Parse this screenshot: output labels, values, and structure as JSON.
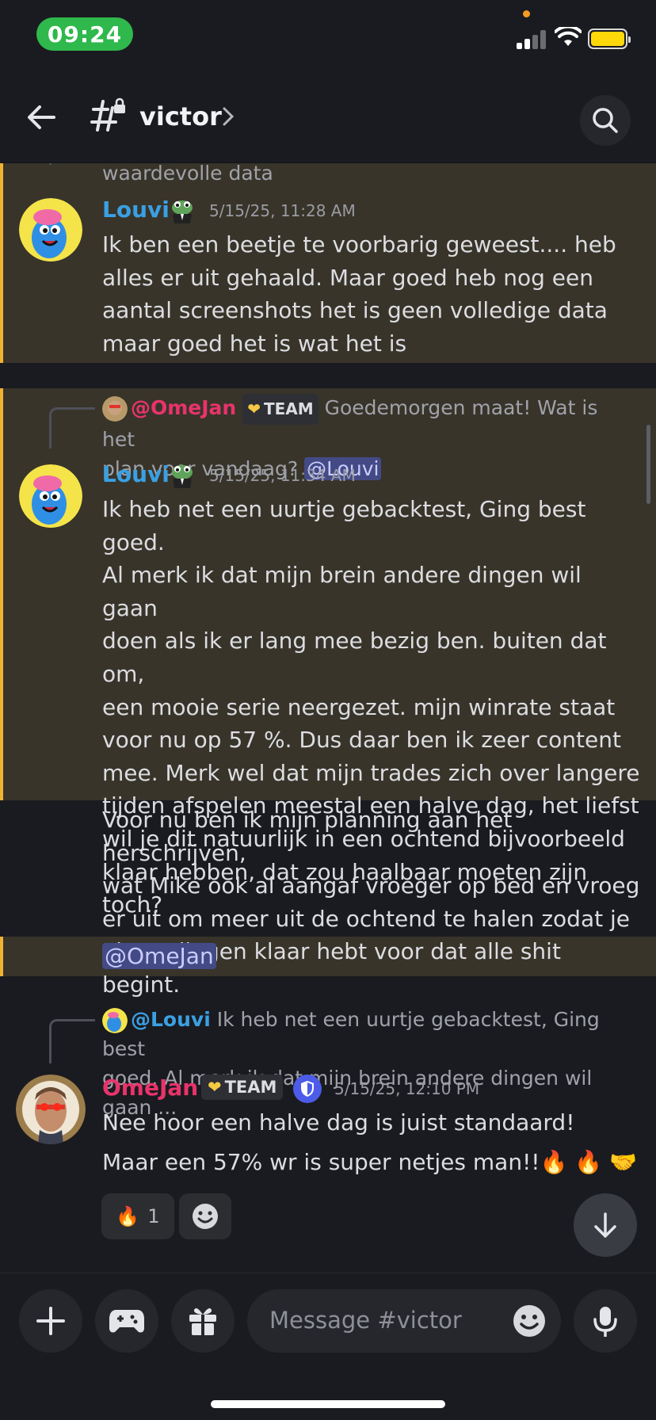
{
  "status_bar": {
    "time": "09:24"
  },
  "header": {
    "channel": "victor",
    "back_icon": "arrow-left-icon",
    "search_icon": "search-icon"
  },
  "messages": [
    {
      "cut_text": "waardevolle data",
      "author": "Louvi",
      "timestamp": "5/15/25, 11:28 AM",
      "lines": [
        "Ik ben een beetje te voorbarig geweest.... heb",
        "alles er uit gehaald. Maar goed heb nog een",
        "aantal screenshots het is geen volledige data",
        "maar goed het is wat het is"
      ]
    },
    {
      "reply": {
        "name": "@OmeJan",
        "badge": "TEAM",
        "text_1": "Goedemorgen maat! Wat is het",
        "text_2": "plan voor vandaag?",
        "mention": "@Louvi"
      },
      "author": "Louvi",
      "timestamp": "5/15/25, 11:34 AM",
      "lines": [
        "Ik heb net een uurtje gebacktest, Ging best goed.",
        "Al merk ik dat mijn brein andere dingen wil gaan",
        "doen als ik er lang mee bezig ben. buiten dat om,",
        "een mooie serie neergezet. mijn winrate staat",
        "voor nu op 57 %.  Dus daar ben ik zeer content",
        "mee.  Merk wel dat mijn trades zich over langere",
        "tijden afspelen meestal een halve dag, het liefst",
        "wil je dit natuurlijk in een ochtend bijvoorbeeld",
        "klaar hebben, dat zou haalbaar moeten zijn toch?"
      ],
      "followup": [
        "Voor nu ben ik mijn planning aan het herschrijven,",
        "wat Mike ook al aangaf vroeger op bed en vroeg",
        "er uit om meer uit de ochtend te halen zodat je",
        "eigen dingen klaar hebt voor dat alle shit begint."
      ],
      "mention": "@OmeJan"
    },
    {
      "reply": {
        "name": "@Louvi",
        "text_1": "Ik heb net een uurtje gebacktest, Ging best",
        "text_2": "goed. Al merk ik dat mijn brein andere dingen wil gaan ..."
      },
      "author": "OmeJan",
      "badge": "TEAM",
      "timestamp": "5/15/25, 12:10 PM",
      "line_1": "Nee hoor een halve dag is juist standaard!",
      "line_2": "Maar een 57% wr is super netjes man!!🔥 🔥 🤝",
      "reaction_count": "1"
    }
  ],
  "composer": {
    "placeholder": "Message #victor"
  },
  "colors": {
    "louvi": "#3aa0e3",
    "omejan": "#e8336b",
    "highlight": "#38342a",
    "highlight_border": "#f0b232",
    "mention_bg": "#434a86"
  }
}
